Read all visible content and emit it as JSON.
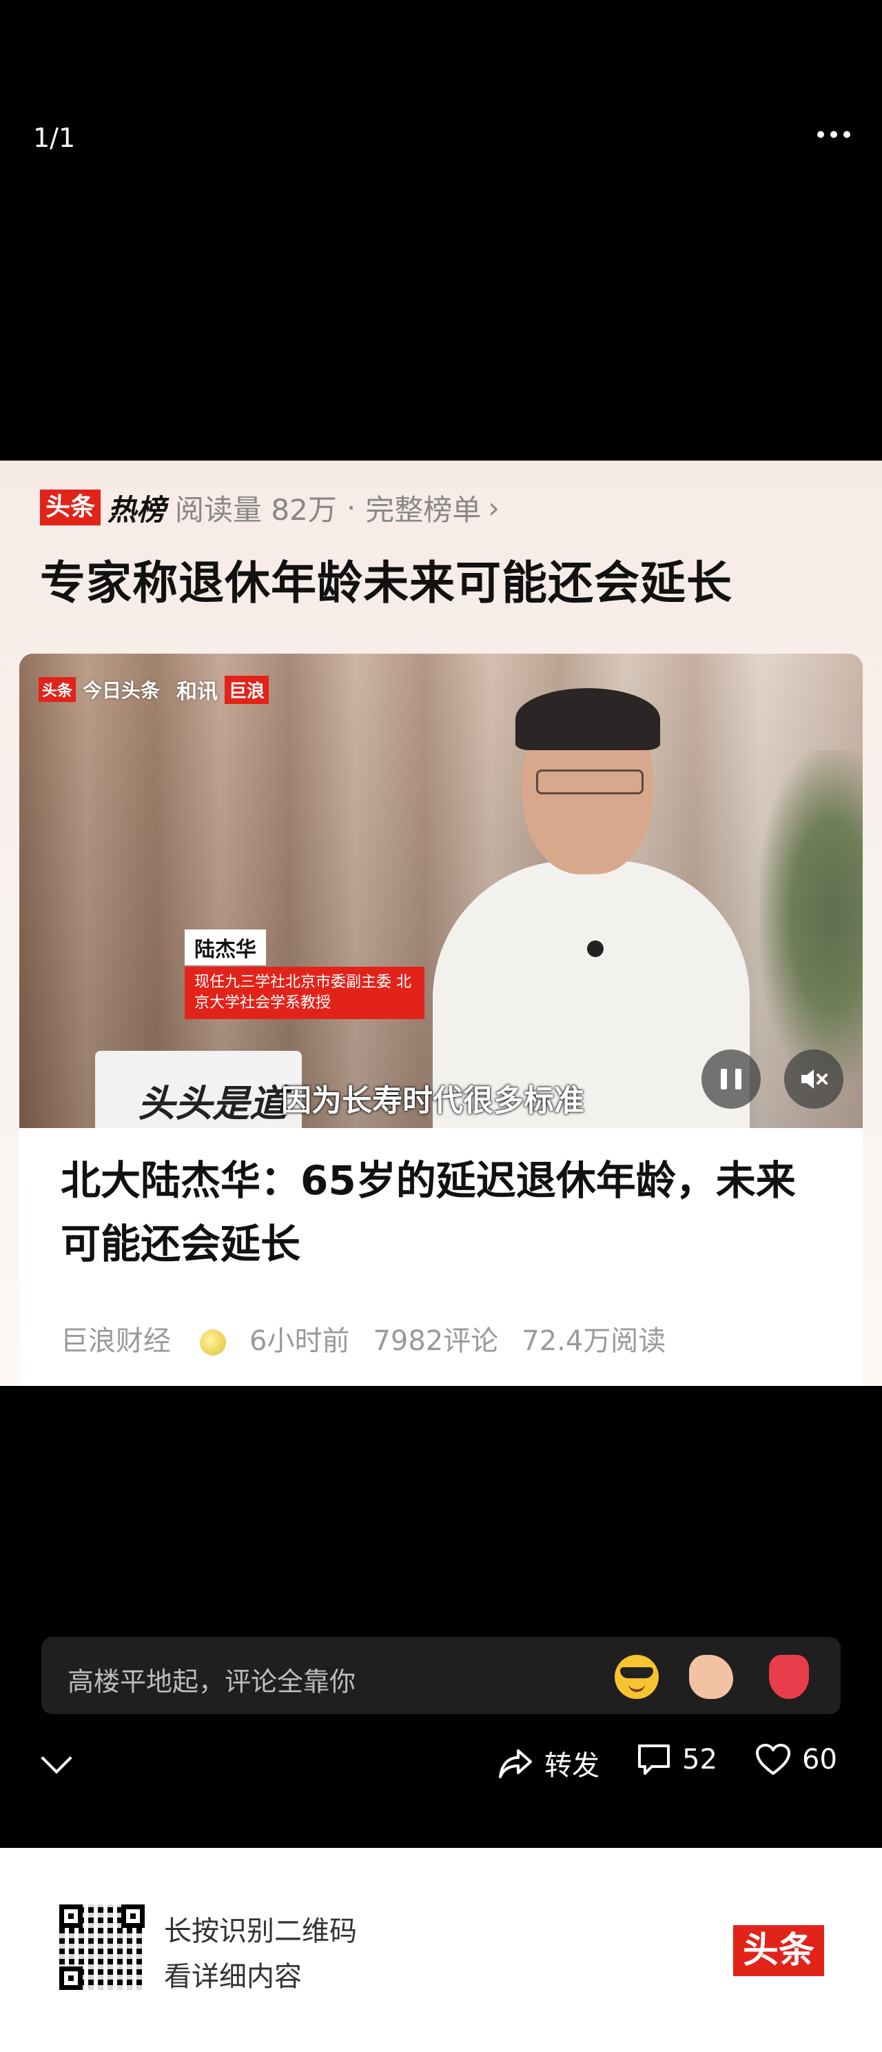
{
  "viewer": {
    "counter": "1/1"
  },
  "hot_list": {
    "logo": "头条",
    "hot_word": "热榜",
    "read_count": "阅读量 82万",
    "separator": "·",
    "full_list_link": "完整榜单",
    "headline": "专家称退休年龄未来可能还会延长"
  },
  "video": {
    "watermark_logo": "头条",
    "watermark_text": "今日头条",
    "watermark_brand": "和讯",
    "watermark_julang": "巨浪",
    "nameplate_name": "陆杰华",
    "nameplate_role": "现任九三学社北京市委副主委 北京大学社会学系教授",
    "laptop_logo": "头头是道",
    "subtitle": "因为长寿时代很多标准"
  },
  "article": {
    "title": "北大陆杰华：65岁的延迟退休年龄，未来可能还会延长",
    "author": "巨浪财经",
    "time": "6小时前",
    "comments": "7982评论",
    "reads": "72.4万阅读"
  },
  "comment_bar": {
    "placeholder": "高楼平地起，评论全靠你"
  },
  "actions": {
    "share_label": "转发",
    "comment_count": "52",
    "like_count": "60"
  },
  "footer": {
    "line1": "长按识别二维码",
    "line2": "看详细内容",
    "logo": "头条"
  },
  "colors": {
    "accent_red": "#e2231a",
    "background_dark": "#000000"
  }
}
